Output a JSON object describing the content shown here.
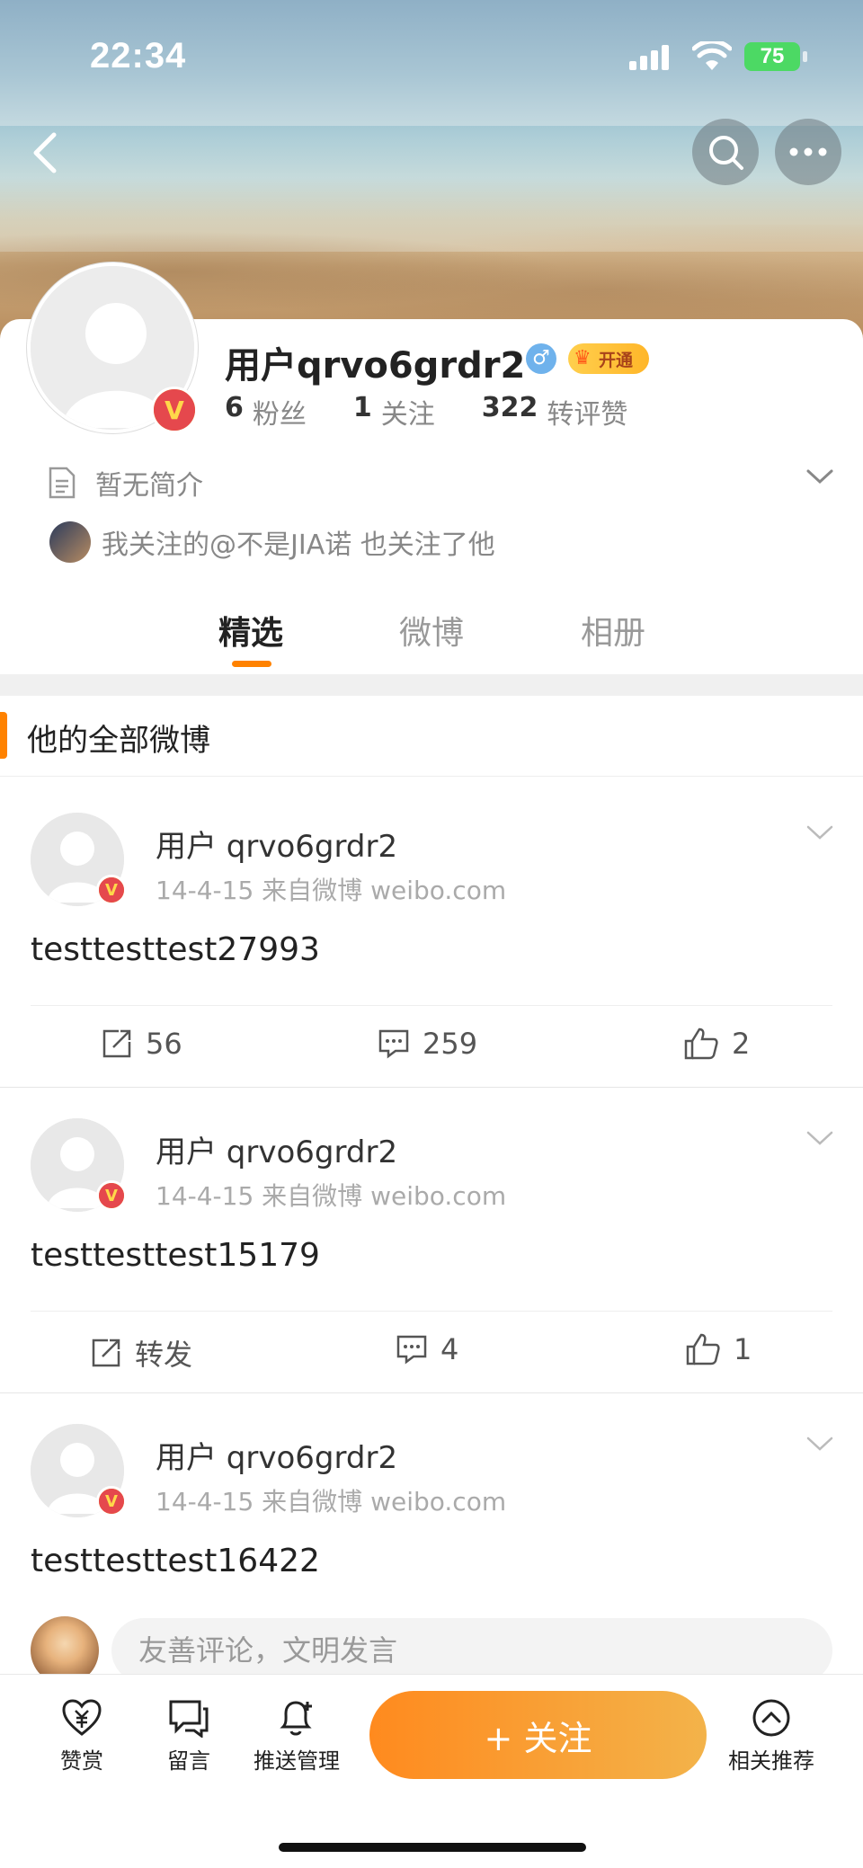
{
  "status": {
    "time": "22:34",
    "battery": "75"
  },
  "profile": {
    "name": "用户qrvo6grdr2",
    "gender_symbol": "♂",
    "vip_label": "开通",
    "stats": [
      {
        "num": "6",
        "label": "粉丝"
      },
      {
        "num": "1",
        "label": "关注"
      },
      {
        "num": "322",
        "label": "转评赞"
      }
    ],
    "intro": "暂无简介",
    "mutual": "我关注的@不是JIA诺 也关注了他"
  },
  "tabs": [
    "精选",
    "微博",
    "相册"
  ],
  "section_title": "他的全部微博",
  "posts": [
    {
      "author": "用户 qrvo6grdr2",
      "meta": "14-4-15  来自微博 weibo.com",
      "content": "testtesttest27993",
      "repost": "56",
      "comment": "259",
      "like": "2"
    },
    {
      "author": "用户 qrvo6grdr2",
      "meta": "14-4-15  来自微博 weibo.com",
      "content": "testtesttest15179",
      "repost": "转发",
      "comment": "4",
      "like": "1"
    },
    {
      "author": "用户 qrvo6grdr2",
      "meta": "14-4-15  来自微博 weibo.com",
      "content": "testtesttest16422"
    }
  ],
  "comment_placeholder": "友善评论，文明发言",
  "bottombar": {
    "reward": "赞赏",
    "message": "留言",
    "push": "推送管理",
    "follow": "+ 关注",
    "recommend": "相关推荐"
  },
  "colors": {
    "accent": "#ff8200",
    "badge_red": "#e5484d",
    "badge_gold": "#f2a300"
  }
}
